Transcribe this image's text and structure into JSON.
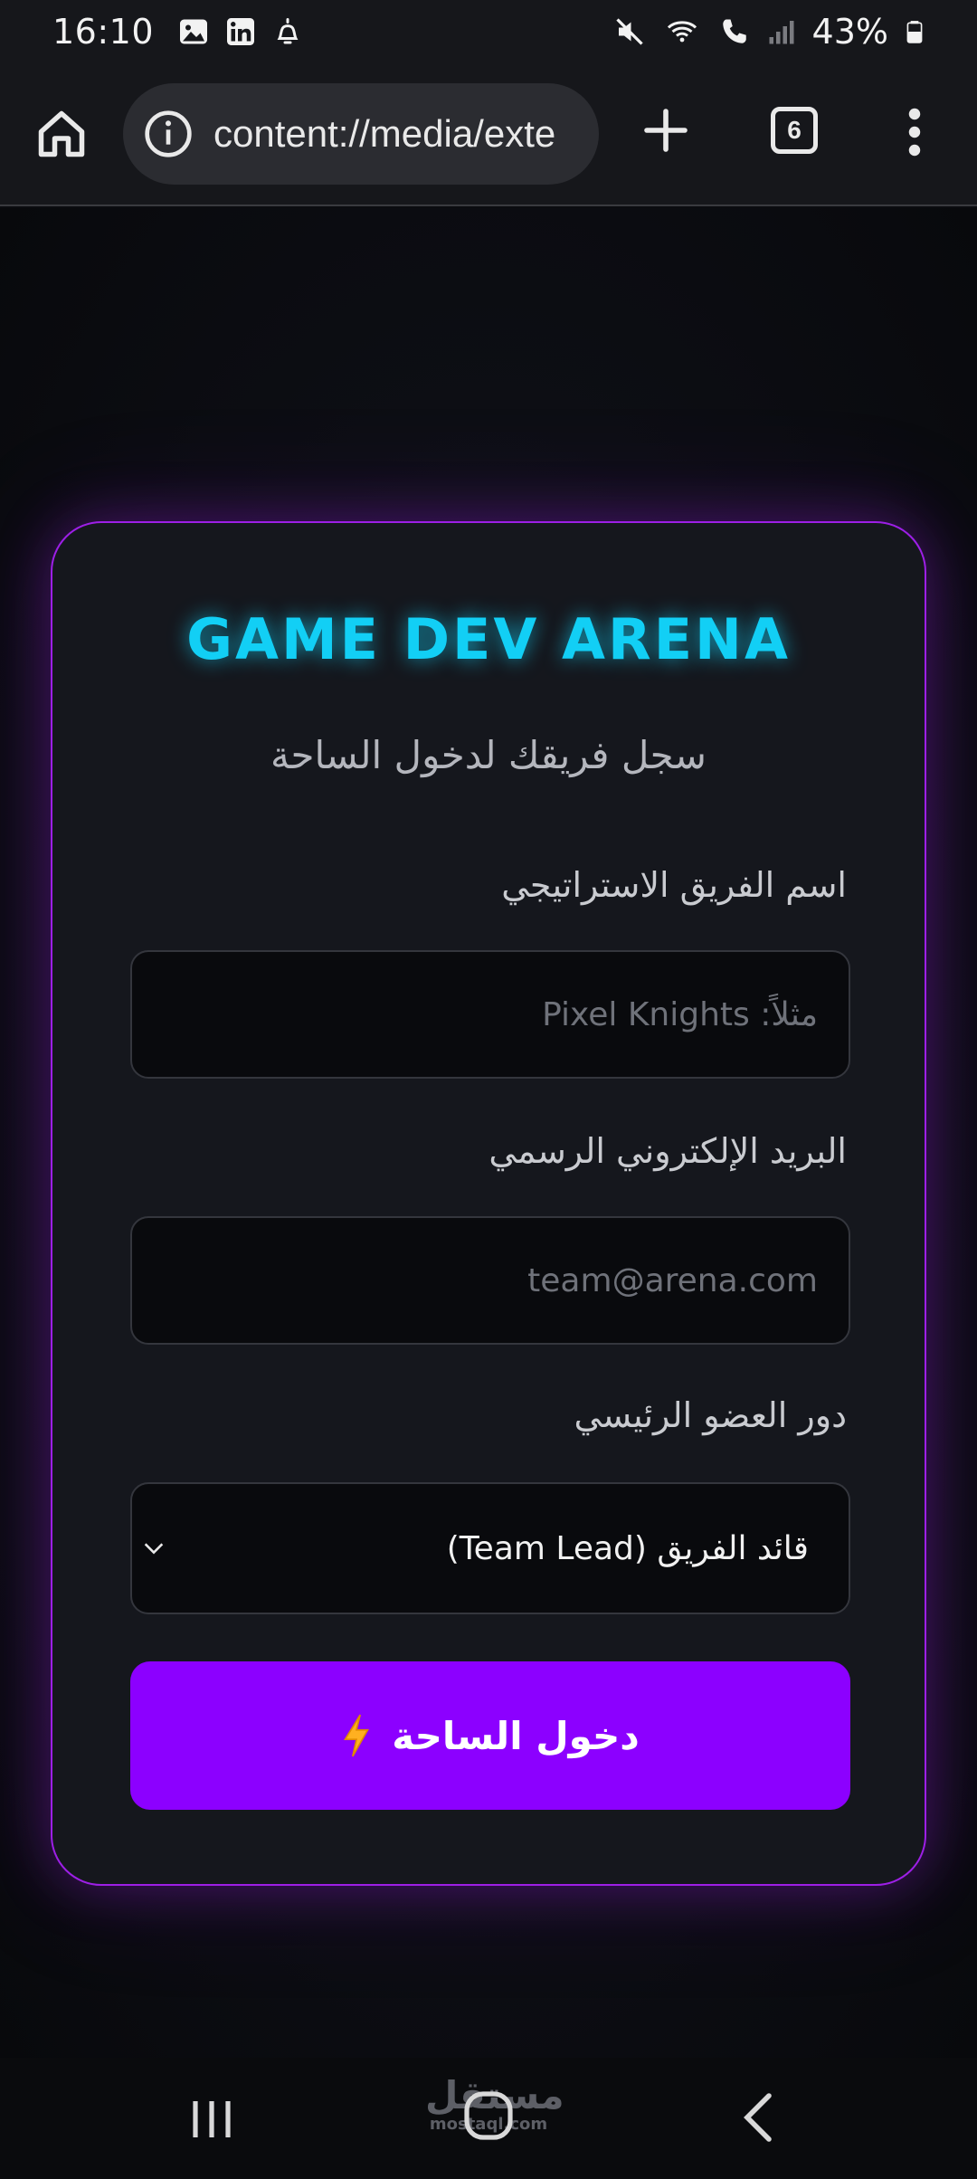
{
  "status_bar": {
    "time": "16:10",
    "battery_text": "43%",
    "left_icons": [
      "gallery-icon",
      "linkedin-icon",
      "notification-bell-icon"
    ],
    "right_icons": [
      "mute-icon",
      "wifi-calling-icon",
      "signal-icon",
      "battery-icon"
    ]
  },
  "browser": {
    "url": "content://media/exte",
    "tab_count": "6",
    "icons": [
      "home-icon",
      "info-icon",
      "plus-icon",
      "tabs-icon",
      "more-vert-icon"
    ]
  },
  "card": {
    "title": "GAME DEV ARENA",
    "subtitle": "سجل فريقك لدخول الساحة",
    "team_name": {
      "label": "اسم الفريق الاستراتيجي",
      "placeholder": "مثلاً: Pixel Knights"
    },
    "email": {
      "label": "البريد الإلكتروني الرسمي",
      "placeholder": "team@arena.com"
    },
    "role": {
      "label": "دور العضو الرئيسي",
      "selected": "قائد الفريق (Team Lead)"
    },
    "submit_label": "دخول الساحة",
    "colors": {
      "accent_purple": "#8c00ff",
      "title_cyan": "#12cff5",
      "card_border": "#9d1fe6"
    }
  },
  "navbar": {
    "watermark_ar": "مستقل",
    "watermark_en": "mostaql.com"
  }
}
